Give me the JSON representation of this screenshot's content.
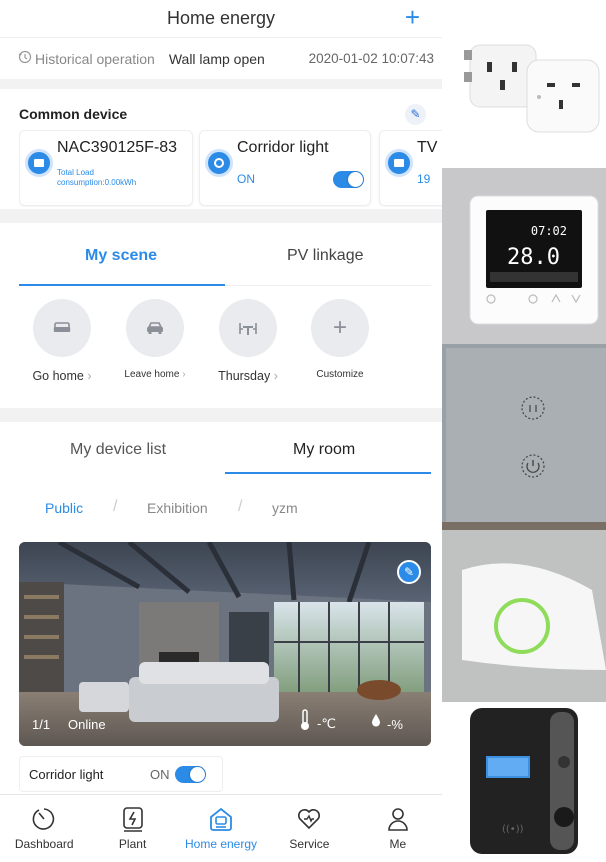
{
  "header": {
    "title": "Home energy",
    "add_icon": "+"
  },
  "history": {
    "label": "Historical operation",
    "operation": "Wall lamp open",
    "timestamp": "2020-01-02 10:07:43"
  },
  "common": {
    "title": "Common device",
    "cards": [
      {
        "name": "NAC390125F-83",
        "sub1": "Total Load",
        "sub2": "consumption:0.00kWh"
      },
      {
        "name": "Corridor light",
        "status": "ON"
      },
      {
        "name": "TV",
        "value": "19"
      }
    ]
  },
  "scene": {
    "tabs": [
      "My scene",
      "PV linkage"
    ],
    "items": [
      {
        "label": "Go home",
        "chev": "›"
      },
      {
        "label": "Leave home",
        "chev": "›"
      },
      {
        "label": "Thursday",
        "chev": "›"
      },
      {
        "label": "Customize",
        "plus": "+"
      }
    ]
  },
  "room": {
    "tabs": [
      "My device list",
      "My room"
    ],
    "filters": [
      "Public",
      "Exhibition",
      "yzm"
    ],
    "sep": "/",
    "photo": {
      "page": "1/1",
      "status": "Online",
      "temp": "-℃",
      "humidity": "-%"
    },
    "device": {
      "name": "Corridor light",
      "status": "ON"
    }
  },
  "nav": [
    {
      "label": "Dashboard",
      "icon": "gauge-icon"
    },
    {
      "label": "Plant",
      "icon": "plant-icon"
    },
    {
      "label": "Home energy",
      "icon": "home-icon"
    },
    {
      "label": "Service",
      "icon": "service-icon"
    },
    {
      "label": "Me",
      "icon": "user-icon"
    }
  ],
  "colors": {
    "accent": "#2b8be6",
    "bg": "#f2f2f2"
  }
}
